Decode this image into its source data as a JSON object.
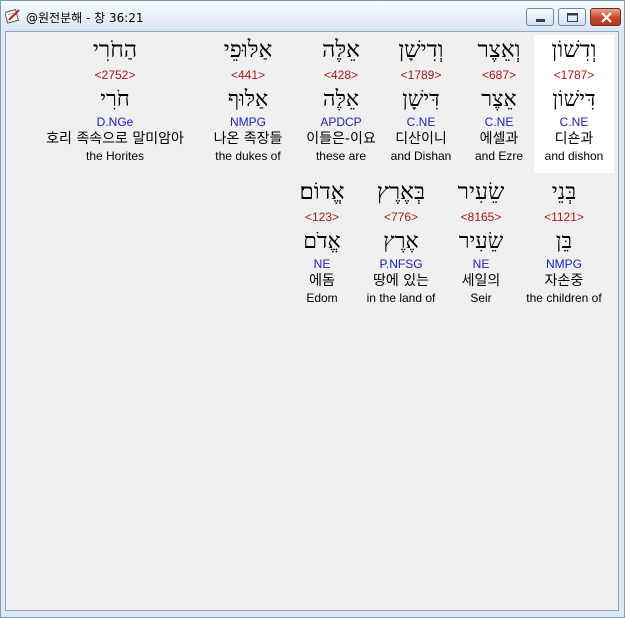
{
  "window": {
    "title": "@원전분해 - 창 36:21"
  },
  "verse": {
    "row1": [
      {
        "hebrew": "וְדִשׁוֹן",
        "strong": "<1787>",
        "lemma": "דִּישׁוֹן",
        "parse": "C.NE",
        "korean": "디숀과",
        "english": "and dishon",
        "selected": true
      },
      {
        "hebrew": "וְאֵצֶר",
        "strong": "<687>",
        "lemma": "אֵצֶר",
        "parse": "C.NE",
        "korean": "에셀과",
        "english": "and Ezre",
        "selected": false
      },
      {
        "hebrew": "וְדִישָׁן",
        "strong": "<1789>",
        "lemma": "דִּישָׁן",
        "parse": "C.NE",
        "korean": "디산이니",
        "english": "and Dishan",
        "selected": false
      },
      {
        "hebrew": "אֵלֶּה",
        "strong": "<428>",
        "lemma": "אֵלֶּה",
        "parse": "APDCP",
        "korean": "이들은-이요",
        "english": "these are",
        "selected": false
      },
      {
        "hebrew": "אַלּוּפֵי",
        "strong": "<441>",
        "lemma": "אַלּוּף",
        "parse": "NMPG",
        "korean": "나온 족장들",
        "english": "the dukes of",
        "selected": false
      },
      {
        "hebrew": "הַחֹרִי",
        "strong": "<2752>",
        "lemma": "חֹרִי",
        "parse": "D.NGe",
        "korean": "호리 족속으로 말미암아",
        "english": "the Horites",
        "selected": false
      }
    ],
    "row2": [
      {
        "hebrew": "בְּנֵי",
        "strong": "<1121>",
        "lemma": "בֵּן",
        "parse": "NMPG",
        "korean": "자손중",
        "english": "the children of",
        "selected": false
      },
      {
        "hebrew": "שֵׂעִיר",
        "strong": "<8165>",
        "lemma": "שֵׂעִיר",
        "parse": "NE",
        "korean": "세일의",
        "english": "Seir",
        "selected": false
      },
      {
        "hebrew": "בְּאֶרֶץ",
        "strong": "<776>",
        "lemma": "אֶרֶץ",
        "parse": "P.NFSG",
        "korean": "땅에 있는",
        "english": "in the land of",
        "selected": false
      },
      {
        "hebrew": "אֱדוֹם׃",
        "strong": "<123>",
        "lemma": "אֱדֹם",
        "parse": "NE",
        "korean": "에돔",
        "english": "Edom",
        "selected": false
      }
    ]
  },
  "colors": {
    "strong": "#a81818",
    "parse": "#2020b8",
    "selected_bg": "#ffffff",
    "client_bg": "#f0f0f0"
  },
  "icons": {
    "app": "notebook-pencil-icon",
    "minimize": "minimize-icon",
    "maximize": "maximize-icon",
    "close": "close-icon"
  }
}
